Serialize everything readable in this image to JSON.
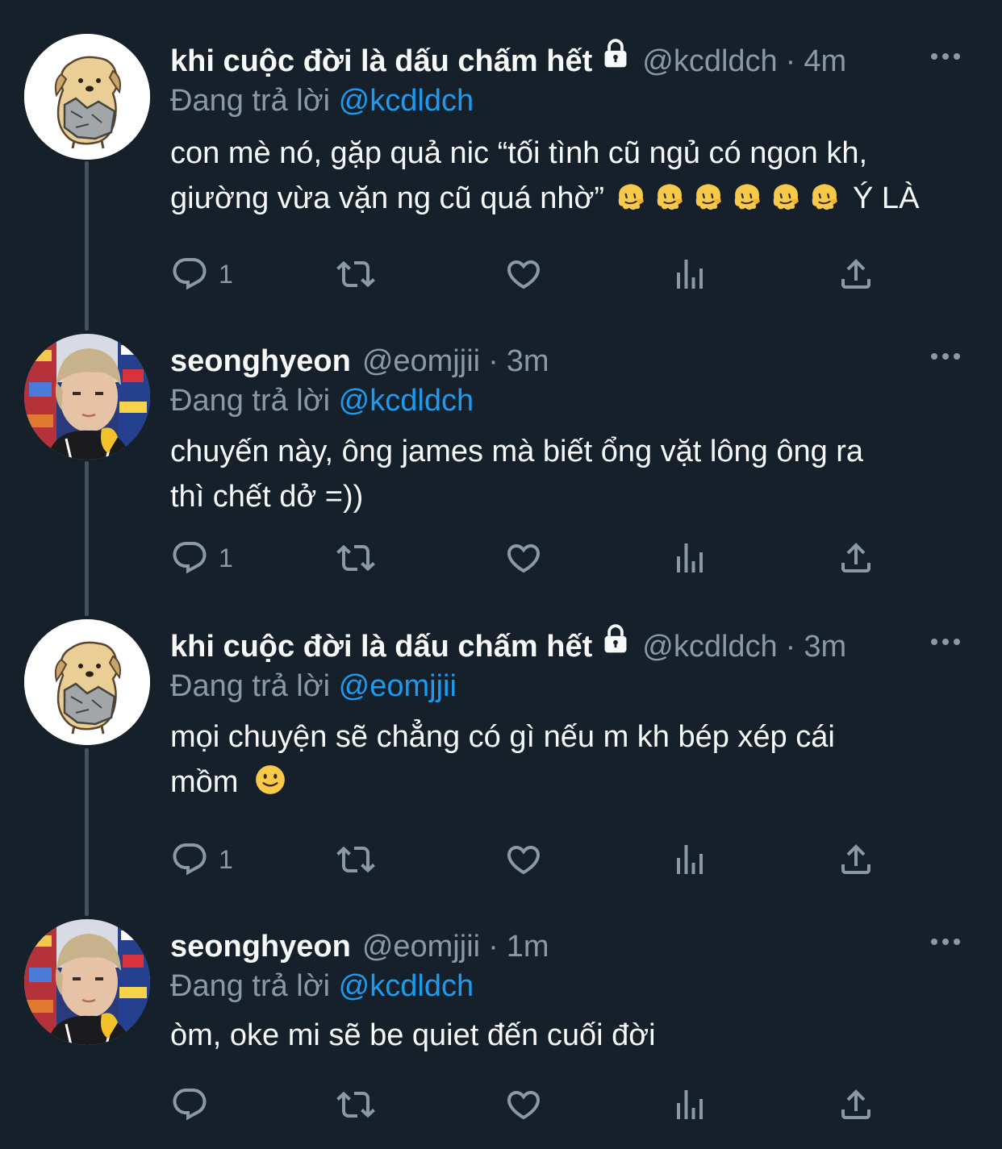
{
  "tweets": [
    {
      "name": "khi cuộc đời là dấu chấm hết",
      "locked": true,
      "handle": "@kcdldch",
      "dot": "·",
      "time": "4m",
      "reply_prefix": "Đang trả lời",
      "reply_to": "@kcdldch",
      "body_line1": "con mè nó, gặp quả nic “tối tình cũ ngủ có ngon kh,",
      "body_line2_text": "giường vừa vặn ng cũ quá nhờ”",
      "body_line2_emoji_name": "melting-face-icon",
      "body_line2_emoji_count": 6,
      "body_line2_tail": "Ý LÀ",
      "reply_count": "1",
      "avatar": "dog-cartoon"
    },
    {
      "name": "seonghyeon",
      "locked": false,
      "handle": "@eomjjii",
      "dot": "·",
      "time": "3m",
      "reply_prefix": "Đang trả lời",
      "reply_to": "@kcdldch",
      "body_line1": "chuyến này, ông james mà biết ổng vặt lông ông ra",
      "body_line2_text": "thì chết dở =))",
      "reply_count": "1",
      "avatar": "person-photo"
    },
    {
      "name": "khi cuộc đời là dấu chấm hết",
      "locked": true,
      "handle": "@kcdldch",
      "dot": "·",
      "time": "3m",
      "reply_prefix": "Đang trả lời",
      "reply_to": "@eomjjii",
      "body_line1": "mọi chuyện sẽ chẳng có gì nếu m kh bép xép cái",
      "body_line2_text": "mồm",
      "body_line2_emoji_name": "slightly-smiling-face-icon",
      "reply_count": "1",
      "avatar": "dog-cartoon"
    },
    {
      "name": "seonghyeon",
      "locked": false,
      "handle": "@eomjjii",
      "dot": "·",
      "time": "1m",
      "reply_prefix": "Đang trả lời",
      "reply_to": "@kcdldch",
      "body_line1": "òm, oke mi sẽ be quiet đến cuối đời",
      "reply_count": "",
      "avatar": "person-photo"
    }
  ],
  "colors": {
    "background": "#15202b",
    "text": "#f7f9f9",
    "secondary": "#8b98a5",
    "accent": "#1d9bf0",
    "thread_line": "#42535f"
  }
}
